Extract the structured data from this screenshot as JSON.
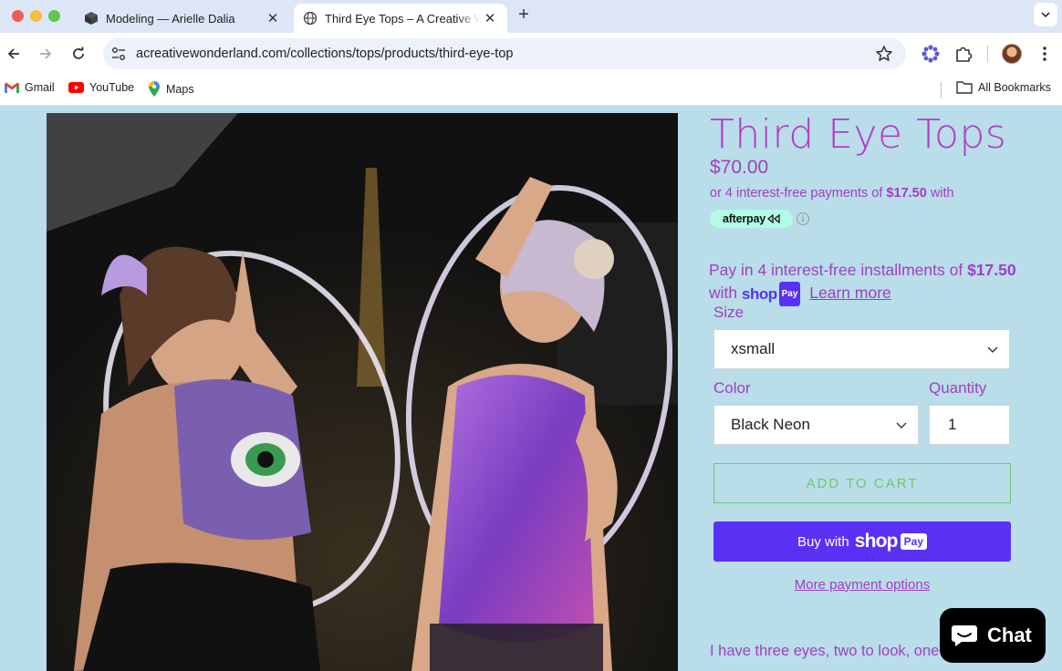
{
  "browser": {
    "tabs": [
      {
        "title": "Modeling — Arielle Dalia"
      },
      {
        "title": "Third Eye Tops – A Creative Wonderland"
      }
    ],
    "url": "acreativewonderland.com/collections/tops/products/third-eye-top",
    "bookmarks": [
      {
        "label": "Gmail",
        "icon": "gmail-icon"
      },
      {
        "label": "YouTube",
        "icon": "youtube-icon"
      },
      {
        "label": "Maps",
        "icon": "maps-icon"
      }
    ],
    "all_bookmarks": "All Bookmarks"
  },
  "product": {
    "title": "Third Eye Tops",
    "price": "$70.00",
    "afterpay": {
      "prefix": "or 4 interest-free payments of",
      "amount": "$17.50",
      "suffix": "with",
      "badge": "afterpay"
    },
    "shoppay": {
      "prefix": "Pay in 4 interest-free installments of",
      "amount": "$17.50",
      "with": "with",
      "logo_word": "shop",
      "logo_pay": "Pay",
      "learn_more": "Learn more"
    },
    "size": {
      "label": "Size",
      "selected": "xsmall"
    },
    "color": {
      "label": "Color",
      "selected": "Black Neon"
    },
    "quantity": {
      "label": "Quantity",
      "value": "1"
    },
    "add_to_cart": "ADD TO CART",
    "buy_now": {
      "prefix": "Buy with",
      "logo_word": "shop",
      "logo_pay": "Pay"
    },
    "more_payment": "More payment options",
    "description_start": "I have three eyes, two to look, one"
  },
  "chat": {
    "label": "Chat"
  },
  "colors": {
    "accent": "#a040c0",
    "shoppay_purple": "#5a31f4",
    "add_cart_green": "#6fc86a",
    "afterpay_mint": "#b2fce4",
    "page_bg": "#b9dde9"
  }
}
